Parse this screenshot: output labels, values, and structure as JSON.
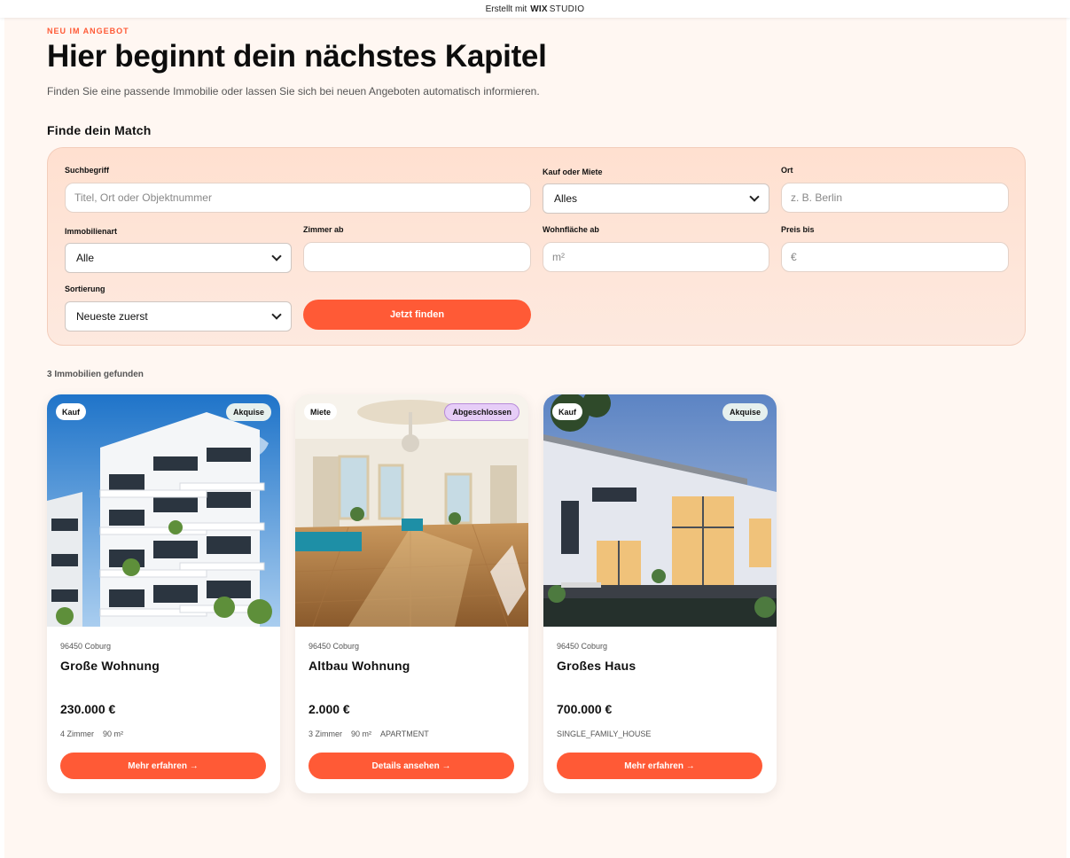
{
  "topbar": {
    "made_with": "Erstellt mit",
    "brand": "WIX",
    "brand_suffix": "STUDIO"
  },
  "hero": {
    "eyebrow": "NEU IM ANGEBOT",
    "title": "Hier beginnt dein nächstes Kapitel",
    "subtitle": "Finden Sie eine passende Immobilie oder lassen Sie sich bei neuen Angeboten automatisch informieren."
  },
  "search": {
    "section_title": "Finde dein Match",
    "keyword": {
      "label": "Suchbegriff",
      "placeholder": "Titel, Ort oder Objektnummer",
      "value": ""
    },
    "buy_or_rent": {
      "label": "Kauf oder Miete",
      "selected": "Alles"
    },
    "location": {
      "label": "Ort",
      "placeholder": "z. B. Berlin",
      "value": ""
    },
    "property_type": {
      "label": "Immobilienart",
      "selected": "Alle"
    },
    "rooms_from": {
      "label": "Zimmer ab",
      "placeholder": "",
      "value": ""
    },
    "living_space_from": {
      "label": "Wohnfläche ab",
      "placeholder": "m²",
      "value": ""
    },
    "price_to": {
      "label": "Preis bis",
      "placeholder": "€",
      "value": ""
    },
    "sort": {
      "label": "Sortierung",
      "selected": "Neueste zuerst"
    },
    "submit_label": "Jetzt finden"
  },
  "results": {
    "count_label": "3 Immobilien gefunden",
    "listings": [
      {
        "type_badge": "Kauf",
        "status_badge": "Akquise",
        "location": "96450 Coburg",
        "title": "Große Wohnung",
        "price": "230.000 €",
        "rooms": "4 Zimmer",
        "area": "90 m²",
        "category": "",
        "button_label": "Mehr erfahren →"
      },
      {
        "type_badge": "Miete",
        "status_badge": "Abgeschlossen",
        "location": "96450 Coburg",
        "title": "Altbau Wohnung",
        "price": "2.000 €",
        "rooms": "3 Zimmer",
        "area": "90 m²",
        "category": "APARTMENT",
        "button_label": "Details ansehen →"
      },
      {
        "type_badge": "Kauf",
        "status_badge": "Akquise",
        "location": "96450 Coburg",
        "title": "Großes Haus",
        "price": "700.000 €",
        "rooms": "",
        "area": "",
        "category": "SINGLE_FAMILY_HOUSE",
        "button_label": "Mehr erfahren →"
      }
    ]
  },
  "colors": {
    "accent": "#ff5a36",
    "page_background": "#fff7f2",
    "panel_background": "#ffe0d0",
    "badge_akquise": "#e6f0ee",
    "badge_abgeschlossen": "#e6cdf7"
  }
}
